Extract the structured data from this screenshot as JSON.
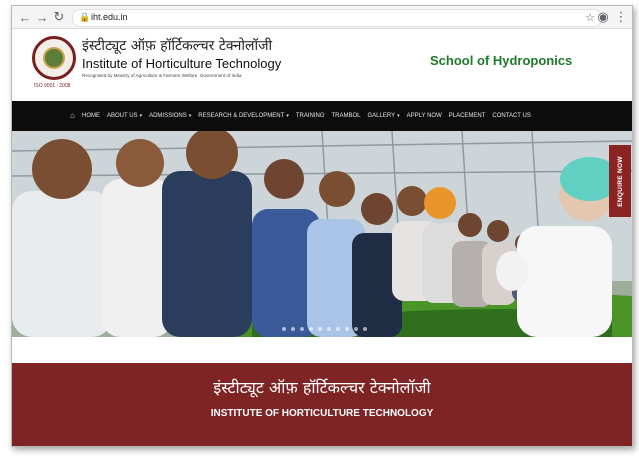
{
  "browser": {
    "url": "iht.edu.in"
  },
  "header": {
    "hindi_name": "इंस्टीट्यूट ऑफ़ हॉर्टिकल्चर टेक्नोलॉजी",
    "english_name": "Institute of Horticulture Technology",
    "recognition": "Recognised by Ministry of Agriculture & Farmers Welfare, Government of India",
    "logo_year": "ISO 9001 : 2008",
    "school_title": "School of Hydroponics"
  },
  "nav": {
    "items": [
      "HOME",
      "ABOUT US",
      "ADMISSIONS",
      "RESEARCH & DEVELOPMENT",
      "TRAINING",
      "TRAMBOL",
      "GALLERY",
      "APPLY NOW",
      "PLACEMENT",
      "CONTACT US"
    ]
  },
  "hero": {
    "enquire_label": "ENQUIRE NOW"
  },
  "banner": {
    "hindi": "इंस्टीट्यूट ऑफ़ हॉर्टिकल्चर टेक्नोलॉजी",
    "english": "INSTITUTE OF HORTICULTURE TECHNOLOGY"
  },
  "colors": {
    "brand_maroon": "#7e2424",
    "school_green": "#1f7a2a",
    "nav_black": "#0c0c0c"
  }
}
